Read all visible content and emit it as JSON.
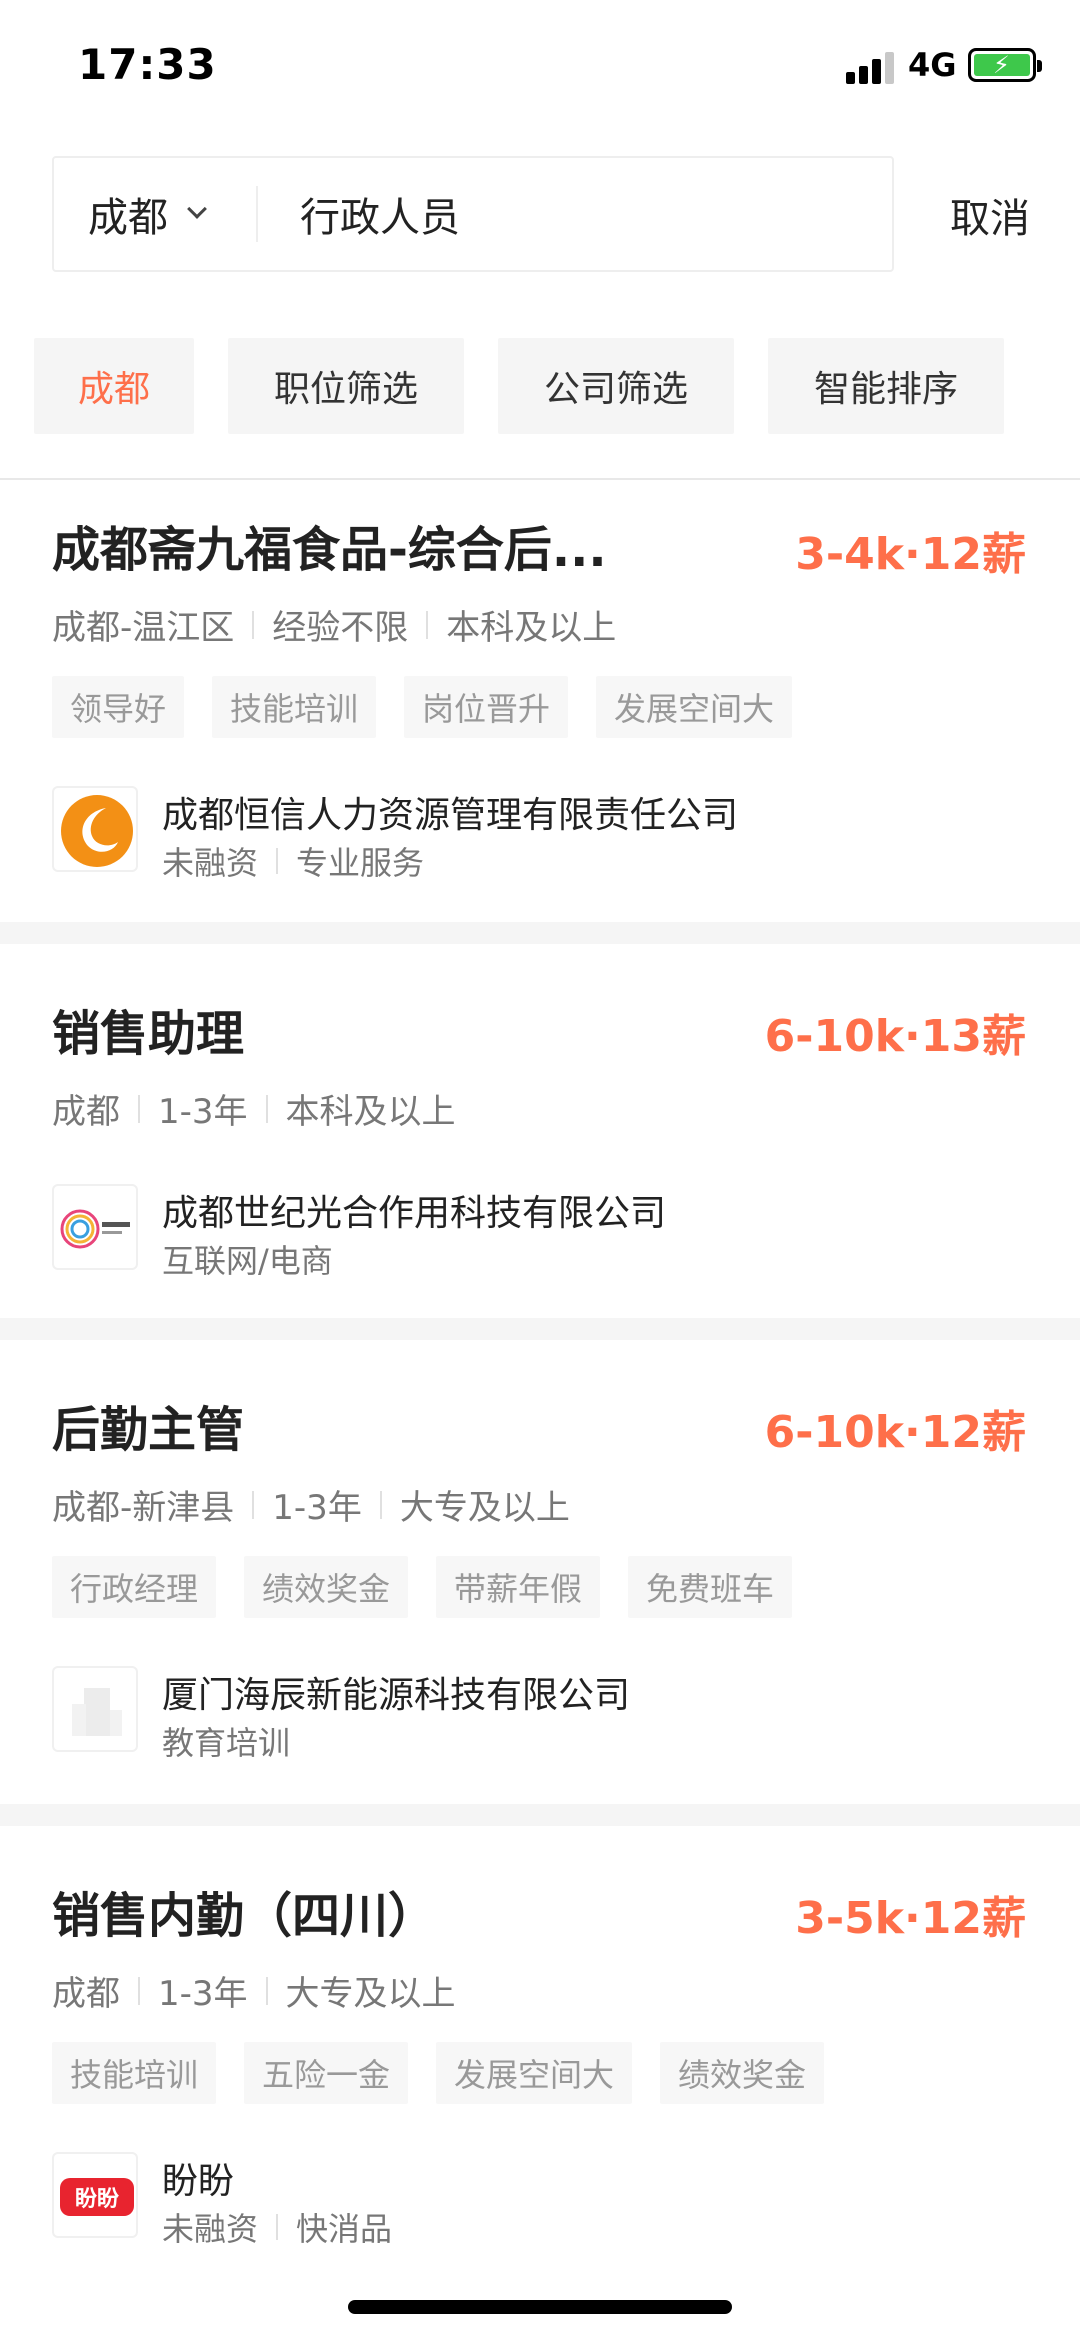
{
  "status_bar": {
    "time": "17:33",
    "network": "4G"
  },
  "search": {
    "city": "成都",
    "query": "行政人员",
    "cancel_label": "取消"
  },
  "filters": [
    {
      "label": "成都"
    },
    {
      "label": "职位筛选"
    },
    {
      "label": "公司筛选"
    },
    {
      "label": "智能排序"
    }
  ],
  "jobs": [
    {
      "title": "成都斋九福食品-综合后...",
      "salary": "3-4k·12薪",
      "meta": [
        "成都-温江区",
        "经验不限",
        "本科及以上"
      ],
      "tags": [
        "领导好",
        "技能培训",
        "岗位晋升",
        "发展空间大"
      ],
      "company": {
        "name": "成都恒信人力资源管理有限责任公司",
        "meta": [
          "未融资",
          "专业服务"
        ]
      }
    },
    {
      "title": "销售助理",
      "salary": "6-10k·13薪",
      "meta": [
        "成都",
        "1-3年",
        "本科及以上"
      ],
      "tags": [],
      "company": {
        "name": "成都世纪光合作用科技有限公司",
        "meta": [
          "互联网/电商"
        ]
      }
    },
    {
      "title": "后勤主管",
      "salary": "6-10k·12薪",
      "meta": [
        "成都-新津县",
        "1-3年",
        "大专及以上"
      ],
      "tags": [
        "行政经理",
        "绩效奖金",
        "带薪年假",
        "免费班车"
      ],
      "company": {
        "name": "厦门海辰新能源科技有限公司",
        "meta": [
          "教育培训"
        ]
      }
    },
    {
      "title": "销售内勤（四川）",
      "salary": "3-5k·12薪",
      "meta": [
        "成都",
        "1-3年",
        "大专及以上"
      ],
      "tags": [
        "技能培训",
        "五险一金",
        "发展空间大",
        "绩效奖金"
      ],
      "company": {
        "name": "盼盼",
        "meta": [
          "未融资",
          "快消品"
        ],
        "logo_text": "盼盼"
      }
    }
  ],
  "colors": {
    "accent": "#fe6f4a",
    "tag_bg": "#f7f7f7",
    "filter_bg": "#f5f5f5"
  }
}
